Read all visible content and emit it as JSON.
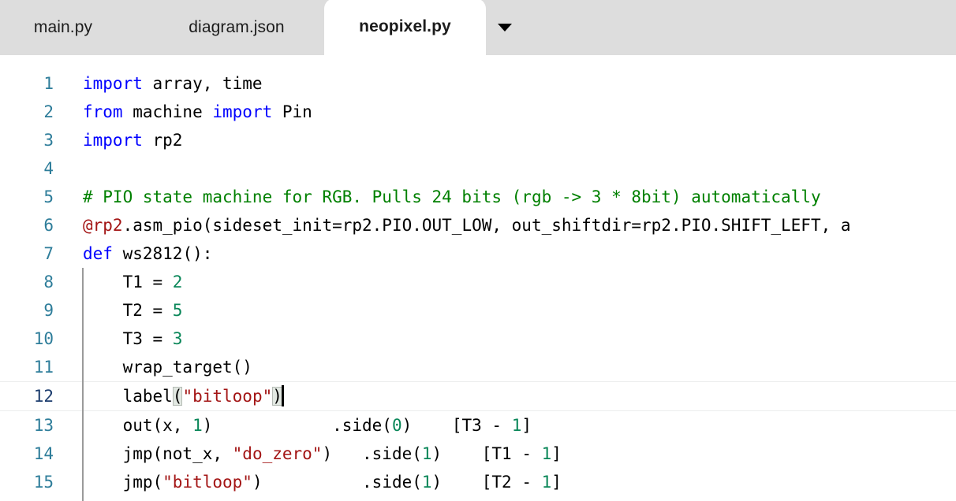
{
  "window": {
    "app": "code-editor"
  },
  "tabbar": {
    "tabs": [
      {
        "label": "main.py",
        "active": false
      },
      {
        "label": "diagram.json",
        "active": false
      },
      {
        "label": "neopixel.py",
        "active": true
      }
    ],
    "menu_icon": "chevron-down-icon"
  },
  "editor": {
    "language": "python",
    "active_line": 12,
    "cursor_line": 12,
    "lines": [
      {
        "n": "1",
        "tokens": [
          {
            "t": "import",
            "c": "kw"
          },
          {
            "t": " array, time",
            "c": "plain"
          }
        ]
      },
      {
        "n": "2",
        "tokens": [
          {
            "t": "from",
            "c": "kw"
          },
          {
            "t": " machine ",
            "c": "plain"
          },
          {
            "t": "import",
            "c": "kw"
          },
          {
            "t": " Pin",
            "c": "plain"
          }
        ]
      },
      {
        "n": "3",
        "tokens": [
          {
            "t": "import",
            "c": "kw"
          },
          {
            "t": " rp2",
            "c": "plain"
          }
        ]
      },
      {
        "n": "4",
        "tokens": []
      },
      {
        "n": "5",
        "tokens": [
          {
            "t": "# PIO state machine for RGB. Pulls 24 bits (rgb -> 3 * 8bit) automatically",
            "c": "cmt"
          }
        ]
      },
      {
        "n": "6",
        "tokens": [
          {
            "t": "@rp2",
            "c": "dec"
          },
          {
            "t": ".asm_pio(sideset_init=rp2.PIO.OUT_LOW, out_shiftdir=rp2.PIO.SHIFT_LEFT, a",
            "c": "plain"
          }
        ]
      },
      {
        "n": "7",
        "tokens": [
          {
            "t": "def",
            "c": "kw"
          },
          {
            "t": " ws2812():",
            "c": "plain"
          }
        ]
      },
      {
        "n": "8",
        "tokens": [
          {
            "t": "    T1 = ",
            "c": "plain"
          },
          {
            "t": "2",
            "c": "num"
          }
        ]
      },
      {
        "n": "9",
        "tokens": [
          {
            "t": "    T2 = ",
            "c": "plain"
          },
          {
            "t": "5",
            "c": "num"
          }
        ]
      },
      {
        "n": "10",
        "tokens": [
          {
            "t": "    T3 = ",
            "c": "plain"
          },
          {
            "t": "3",
            "c": "num"
          }
        ]
      },
      {
        "n": "11",
        "tokens": [
          {
            "t": "    wrap_target()",
            "c": "plain"
          }
        ]
      },
      {
        "n": "12",
        "tokens": [
          {
            "t": "    label",
            "c": "plain"
          },
          {
            "t": "(",
            "c": "plain brk"
          },
          {
            "t": "\"bitloop\"",
            "c": "str"
          },
          {
            "t": ")",
            "c": "plain brk"
          }
        ],
        "cursor_after": true
      },
      {
        "n": "13",
        "tokens": [
          {
            "t": "    out(x, ",
            "c": "plain"
          },
          {
            "t": "1",
            "c": "num"
          },
          {
            "t": ")            .side(",
            "c": "plain"
          },
          {
            "t": "0",
            "c": "num"
          },
          {
            "t": ")    [T3 - ",
            "c": "plain"
          },
          {
            "t": "1",
            "c": "num"
          },
          {
            "t": "]",
            "c": "plain"
          }
        ]
      },
      {
        "n": "14",
        "tokens": [
          {
            "t": "    jmp(not_x, ",
            "c": "plain"
          },
          {
            "t": "\"do_zero\"",
            "c": "str"
          },
          {
            "t": ")   .side(",
            "c": "plain"
          },
          {
            "t": "1",
            "c": "num"
          },
          {
            "t": ")    [T1 - ",
            "c": "plain"
          },
          {
            "t": "1",
            "c": "num"
          },
          {
            "t": "]",
            "c": "plain"
          }
        ]
      },
      {
        "n": "15",
        "tokens": [
          {
            "t": "    jmp(",
            "c": "plain"
          },
          {
            "t": "\"bitloop\"",
            "c": "str"
          },
          {
            "t": ")          .side(",
            "c": "plain"
          },
          {
            "t": "1",
            "c": "num"
          },
          {
            "t": ")    [T2 - ",
            "c": "plain"
          },
          {
            "t": "1",
            "c": "num"
          },
          {
            "t": "]",
            "c": "plain"
          }
        ]
      }
    ]
  },
  "colors": {
    "tabbar_bg": "#dddddd",
    "active_tab_bg": "#ffffff",
    "editor_bg": "#ffffff",
    "gutter_text": "#2e7d9a",
    "gutter_active_text": "#1c3d6e",
    "keyword": "#0000ff",
    "comment": "#008000",
    "string": "#a31515",
    "number": "#098658",
    "decorator": "#a31515",
    "indent_guide": "#9a9a9a",
    "bracket_match_bg": "#e2e8e2",
    "active_line_border": "#eceded",
    "cursor": "#000000"
  }
}
